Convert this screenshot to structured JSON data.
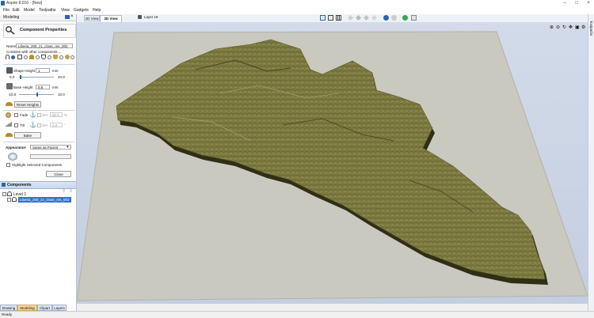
{
  "window": {
    "title": "Aspire 8.016 - [New]"
  },
  "menu": [
    "File",
    "Edit",
    "Model",
    "Toolpaths",
    "View",
    "Gadgets",
    "Help"
  ],
  "panel": {
    "title": "Modeling",
    "heading": "Component Properties",
    "name_label": "Name",
    "name_value": "Liberia_200_z1_close_res_002",
    "combine_label": "Combine with other components ...",
    "shape_height_label": "Shape Height",
    "shape_height_value": "1",
    "shape_unit": "mm",
    "shape_min": "0.0",
    "shape_max": "20.0",
    "shape_fill": 0.05,
    "base_height_label": "Base Height",
    "base_height_value": "0.5",
    "base_unit": "mm",
    "base_min": "-10.0",
    "base_max": "10.0",
    "base_fill": 0.52,
    "reset_label": "Reset Heights",
    "fade_label": "Fade",
    "fade_set": "Set",
    "fade_value": "50.0",
    "fade_unit": "%",
    "tilt_label": "Tilt",
    "tilt_set": "Set",
    "tilt_value": "0.0",
    "tilt_unit": "°",
    "bake_label": "Bake",
    "appearance_label": "Appearance",
    "appearance_value": "Same as Parent",
    "highlight_label": "Highlight Selected Components",
    "close_label": "Close"
  },
  "components": {
    "title": "Components",
    "level": "Level 1",
    "item": "Liberia_200_z1_close_res_002"
  },
  "bottom_tabs": [
    "Drawing",
    "Modeling",
    "Clipart",
    "Layers"
  ],
  "view_tabs": [
    "2D View",
    "3D View"
  ],
  "layer_label": "Layer 1",
  "right_tab": "Toolpaths",
  "status": "Ready",
  "colors": {
    "terrain": "#7b7a3e",
    "terrain_side": "#2e2d15",
    "plate": "#c9c8bd",
    "viewport": "#c7d3e6",
    "accent": "#2b64b0"
  }
}
